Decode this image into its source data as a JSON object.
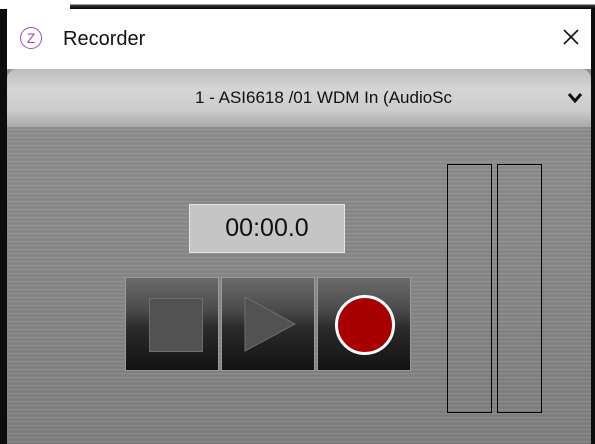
{
  "window": {
    "title": "Recorder",
    "icon_glyph": "Z",
    "icon_name": "app-logo-icon",
    "close_icon": "close-icon"
  },
  "device": {
    "selected": "1 - ASI6618 /01 WDM In (AudioSc",
    "dropdown_icon": "chevron-down-icon"
  },
  "timer": {
    "value": "00:00.0"
  },
  "transport": {
    "stop_icon": "stop-icon",
    "play_icon": "play-icon",
    "record_icon": "record-icon",
    "record_color": "#a80000"
  },
  "meters": {
    "left_level": 0,
    "right_level": 0
  },
  "colors": {
    "accent": "#a04bb8",
    "window_border": "#0d0d0d",
    "panel": "#8b8b8b"
  }
}
